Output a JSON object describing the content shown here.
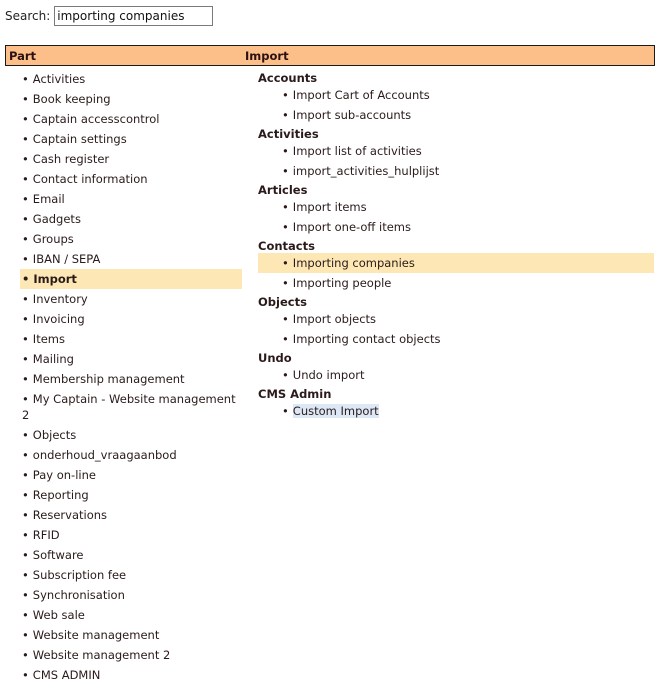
{
  "search": {
    "label": "Search:",
    "value": "importing companies"
  },
  "header": {
    "part_label": "Part",
    "import_label": "Import"
  },
  "colors": {
    "header_bg": "#fdbf8a",
    "selected_bg": "#fde8b5",
    "focus_bg": "#dde8f6"
  },
  "bullet": "•",
  "parts": [
    {
      "label": "Activities"
    },
    {
      "label": "Book keeping"
    },
    {
      "label": "Captain accesscontrol"
    },
    {
      "label": "Captain settings"
    },
    {
      "label": "Cash register"
    },
    {
      "label": "Contact information"
    },
    {
      "label": "Email"
    },
    {
      "label": "Gadgets"
    },
    {
      "label": "Groups"
    },
    {
      "label": "IBAN / SEPA"
    },
    {
      "label": "Import",
      "selected": true
    },
    {
      "label": "Inventory"
    },
    {
      "label": "Invoicing"
    },
    {
      "label": "Items"
    },
    {
      "label": "Mailing"
    },
    {
      "label": "Membership management"
    },
    {
      "label": "My Captain - Website management 2",
      "wrap": true
    },
    {
      "label": "Objects"
    },
    {
      "label": "onderhoud_vraagaanbod"
    },
    {
      "label": "Pay on-line"
    },
    {
      "label": "Reporting"
    },
    {
      "label": "Reservations"
    },
    {
      "label": "RFID"
    },
    {
      "label": "Software"
    },
    {
      "label": "Subscription fee"
    },
    {
      "label": "Synchronisation"
    },
    {
      "label": "Web sale"
    },
    {
      "label": "Website management"
    },
    {
      "label": "Website management 2"
    },
    {
      "label": "CMS ADMIN"
    }
  ],
  "import_groups": [
    {
      "title": "Accounts",
      "items": [
        {
          "label": "Import Cart of Accounts"
        },
        {
          "label": "Import sub-accounts"
        }
      ]
    },
    {
      "title": "Activities",
      "items": [
        {
          "label": "Import list of activities"
        },
        {
          "label": "import_activities_hulplijst"
        }
      ]
    },
    {
      "title": "Articles",
      "items": [
        {
          "label": "Import items"
        },
        {
          "label": "Import one-off items"
        }
      ]
    },
    {
      "title": "Contacts",
      "items": [
        {
          "label": "Importing companies",
          "selected": true
        },
        {
          "label": "Importing people"
        }
      ]
    },
    {
      "title": "Objects",
      "items": [
        {
          "label": "Import objects"
        },
        {
          "label": "Importing contact objects"
        }
      ]
    },
    {
      "title": "Undo",
      "items": [
        {
          "label": "Undo import"
        }
      ]
    },
    {
      "title": "CMS Admin",
      "items": [
        {
          "label": "Custom Import",
          "focused": true
        }
      ]
    }
  ]
}
